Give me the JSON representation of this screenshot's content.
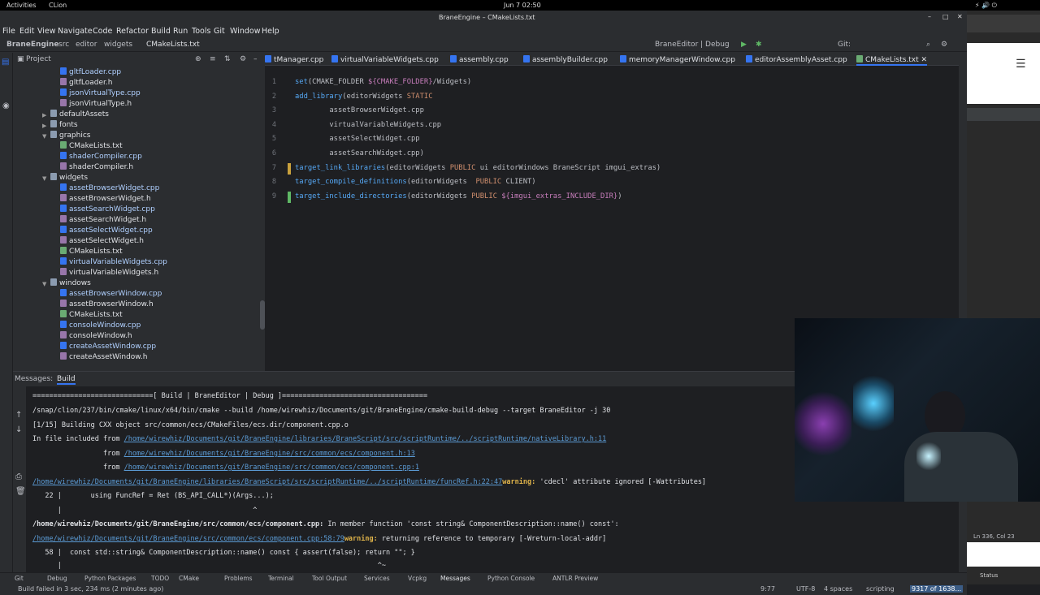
{
  "system": {
    "activities": "Activities",
    "app": "CLion",
    "clock": "Jun 7  02:50"
  },
  "window": {
    "title": "BraneEngine – CMakeLists.txt"
  },
  "menu": [
    "File",
    "Edit",
    "View",
    "Navigate",
    "Code",
    "Refactor",
    "Build",
    "Run",
    "Tools",
    "Git",
    "Window",
    "Help"
  ],
  "breadcrumb": [
    "BraneEngine",
    "src",
    "editor",
    "widgets",
    "CMakeLists.txt"
  ],
  "run_config": "BraneEditor | Debug",
  "git_label": "Git:",
  "project": {
    "header": "Project",
    "items": [
      {
        "label": "gltfLoader.cpp",
        "type": "cpp",
        "indent": 1
      },
      {
        "label": "gltfLoader.h",
        "type": "h",
        "indent": 1
      },
      {
        "label": "jsonVirtualType.cpp",
        "type": "cpp",
        "indent": 1
      },
      {
        "label": "jsonVirtualType.h",
        "type": "h",
        "indent": 1
      },
      {
        "label": "defaultAssets",
        "type": "folder",
        "indent": 0,
        "collapsed": true
      },
      {
        "label": "fonts",
        "type": "folder",
        "indent": 0,
        "collapsed": true
      },
      {
        "label": "graphics",
        "type": "folder",
        "indent": 0,
        "collapsed": false
      },
      {
        "label": "CMakeLists.txt",
        "type": "txt",
        "indent": 1
      },
      {
        "label": "shaderCompiler.cpp",
        "type": "cpp",
        "indent": 1
      },
      {
        "label": "shaderCompiler.h",
        "type": "h",
        "indent": 1
      },
      {
        "label": "widgets",
        "type": "folder",
        "indent": 0,
        "collapsed": false
      },
      {
        "label": "assetBrowserWidget.cpp",
        "type": "cpp",
        "indent": 1
      },
      {
        "label": "assetBrowserWidget.h",
        "type": "h",
        "indent": 1
      },
      {
        "label": "assetSearchWidget.cpp",
        "type": "cpp",
        "indent": 1
      },
      {
        "label": "assetSearchWidget.h",
        "type": "h",
        "indent": 1
      },
      {
        "label": "assetSelectWidget.cpp",
        "type": "cpp",
        "indent": 1
      },
      {
        "label": "assetSelectWidget.h",
        "type": "h",
        "indent": 1
      },
      {
        "label": "CMakeLists.txt",
        "type": "txt",
        "indent": 1
      },
      {
        "label": "virtualVariableWidgets.cpp",
        "type": "cpp",
        "indent": 1
      },
      {
        "label": "virtualVariableWidgets.h",
        "type": "h",
        "indent": 1
      },
      {
        "label": "windows",
        "type": "folder",
        "indent": 0,
        "collapsed": false
      },
      {
        "label": "assetBrowserWindow.cpp",
        "type": "cpp",
        "indent": 1
      },
      {
        "label": "assetBrowserWindow.h",
        "type": "h",
        "indent": 1
      },
      {
        "label": "CMakeLists.txt",
        "type": "txt",
        "indent": 1
      },
      {
        "label": "consoleWindow.cpp",
        "type": "cpp",
        "indent": 1
      },
      {
        "label": "consoleWindow.h",
        "type": "h",
        "indent": 1
      },
      {
        "label": "createAssetWindow.cpp",
        "type": "cpp",
        "indent": 1
      },
      {
        "label": "createAssetWindow.h",
        "type": "h",
        "indent": 1
      }
    ]
  },
  "tabs": [
    "tManager.cpp",
    "virtualVariableWidgets.cpp",
    "assembly.cpp",
    "assemblyBuilder.cpp",
    "memoryManagerWindow.cpp",
    "editorAssemblyAsset.cpp",
    "CMakeLists.txt"
  ],
  "code": [
    {
      "n": "1",
      "t": "set(CMAKE_FOLDER ${CMAKE_FOLDER}/Widgets)"
    },
    {
      "n": "2",
      "t": "add_library(editorWidgets STATIC"
    },
    {
      "n": "3",
      "t": "        assetBrowserWidget.cpp"
    },
    {
      "n": "4",
      "t": "        virtualVariableWidgets.cpp"
    },
    {
      "n": "5",
      "t": "        assetSelectWidget.cpp"
    },
    {
      "n": "6",
      "t": "        assetSearchWidget.cpp)"
    },
    {
      "n": "7",
      "t": "target_link_libraries(editorWidgets PUBLIC ui editorWindows BraneScript imgui_extras)"
    },
    {
      "n": "8",
      "t": "target_compile_definitions(editorWidgets  PUBLIC CLIENT)"
    },
    {
      "n": "9",
      "t": "target_include_directories(editorWidgets PUBLIC ${imgui_extras_INCLUDE_DIR})"
    }
  ],
  "messages": {
    "label": "Messages:",
    "tab": "Build",
    "lines": [
      "=============================[ Build | BraneEditor | Debug ]===================================",
      "/snap/clion/237/bin/cmake/linux/x64/bin/cmake --build /home/wirewhiz/Documents/git/BraneEngine/cmake-build-debug --target BraneEditor -j 30",
      "[1/15] Building CXX object src/common/ecs/CMakeFiles/ecs.dir/component.cpp.o",
      "In file included from ",
      "/home/wirewhiz/Documents/git/BraneEngine/libraries/BraneScript/src/scriptRuntime/../scriptRuntime/nativeLibrary.h:11",
      "                 from ",
      "/home/wirewhiz/Documents/git/BraneEngine/src/common/ecs/component.h:13",
      "/home/wirewhiz/Documents/git/BraneEngine/src/common/ecs/component.cpp:1",
      "/home/wirewhiz/Documents/git/BraneEngine/libraries/BraneScript/src/scriptRuntime/../scriptRuntime/funcRef.h:22:47",
      "warning:",
      " 'cdecl' attribute ignored [-Wattributes]",
      "   22 |       using FuncRef = Ret (BS_API_CALL*)(Args...);",
      "      |                                              ^",
      "/home/wirewhiz/Documents/git/BraneEngine/src/common/ecs/component.cpp:",
      " In member function 'const string& ComponentDescription::name() const':",
      "/home/wirewhiz/Documents/git/BraneEngine/src/common/ecs/component.cpp:58:79",
      " returning reference to temporary [-Wreturn-local-addr]",
      "   58 |  const std::string& ComponentDescription::name() const { assert(false); return \"\"; }",
      "      |                                                                            ^~"
    ]
  },
  "bottom_tabs": [
    "Git",
    "Debug",
    "Python Packages",
    "TODO",
    "CMake",
    "Problems",
    "Terminal",
    "Tool Output",
    "Services",
    "Vcpkg",
    "Messages",
    "Python Console",
    "ANTLR Preview"
  ],
  "status": {
    "left": "Build failed in 3 sec, 234 ms (2 minutes ago)",
    "position": "9:77",
    "encoding": "UTF-8",
    "indent": "4 spaces",
    "lang": "scripting",
    "memory": "9317 of 1638..."
  },
  "ext": {
    "status": "Status",
    "pos": "Ln 336, Col 23"
  }
}
